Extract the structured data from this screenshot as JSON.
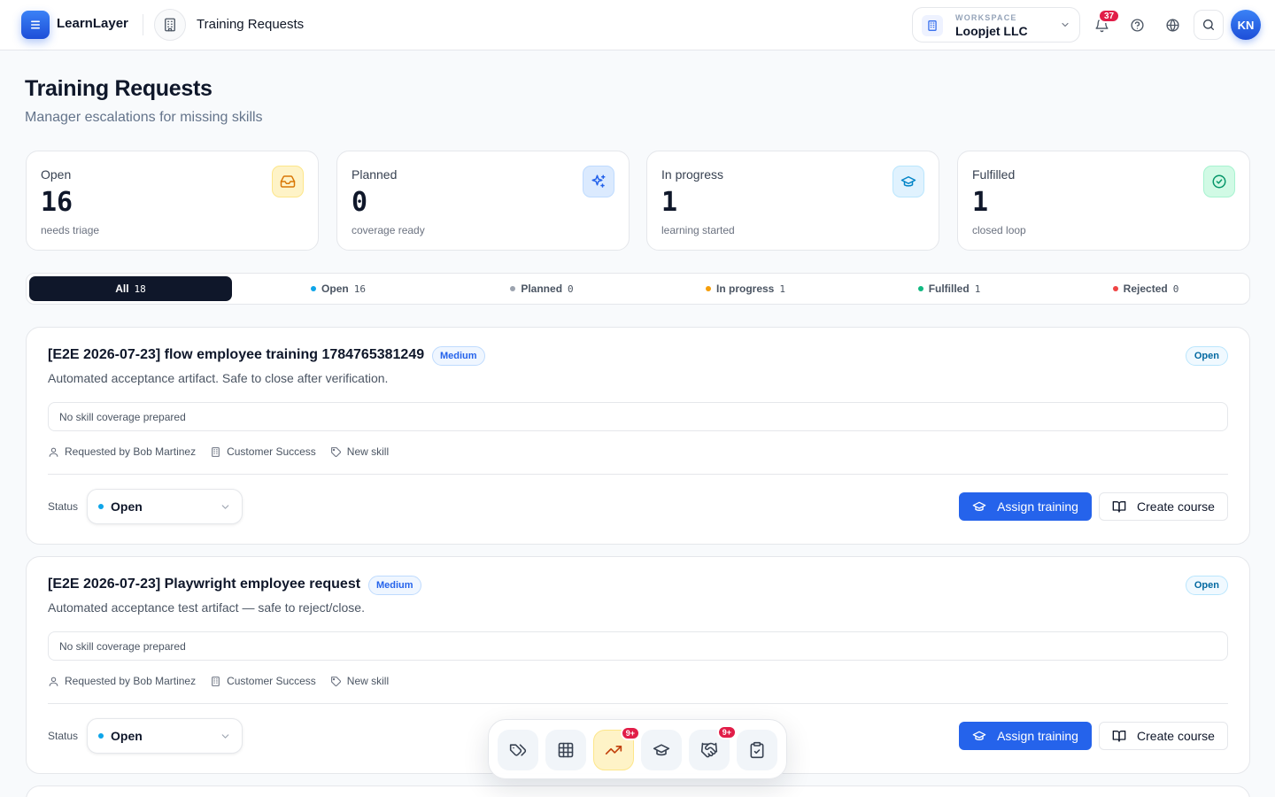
{
  "app": {
    "brand": "LearnLayer",
    "page_breadcrumb": "Training Requests"
  },
  "header": {
    "workspace_label": "WORKSPACE",
    "workspace_name": "Loopjet LLC",
    "notification_count": "37",
    "avatar_initials": "KN"
  },
  "page": {
    "title": "Training Requests",
    "subtitle": "Manager escalations for missing skills"
  },
  "stats": [
    {
      "label": "Open",
      "value": "16",
      "note": "needs triage",
      "icon": "inbox-icon",
      "color": "#d97706"
    },
    {
      "label": "Planned",
      "value": "0",
      "note": "coverage ready",
      "icon": "sparkles-icon",
      "color": "#2563eb"
    },
    {
      "label": "In progress",
      "value": "1",
      "note": "learning started",
      "icon": "graduation-cap-icon",
      "color": "#0284c7"
    },
    {
      "label": "Fulfilled",
      "value": "1",
      "note": "closed loop",
      "icon": "check-circle-icon",
      "color": "#059669"
    }
  ],
  "tabs": [
    {
      "label": "All",
      "count": "18",
      "dot": ""
    },
    {
      "label": "Open",
      "count": "16",
      "dot": "#0ea5e9"
    },
    {
      "label": "Planned",
      "count": "0",
      "dot": "#9ca3af"
    },
    {
      "label": "In progress",
      "count": "1",
      "dot": "#f59e0b"
    },
    {
      "label": "Fulfilled",
      "count": "1",
      "dot": "#10b981"
    },
    {
      "label": "Rejected",
      "count": "0",
      "dot": "#ef4444"
    }
  ],
  "requests": [
    {
      "title": "[E2E 2026-07-23] flow employee training 1784765381249",
      "priority": "Medium",
      "state": "Open",
      "description": "Automated acceptance artifact. Safe to close after verification.",
      "coverage": "No skill coverage prepared",
      "requested_by": "Requested by Bob Martinez",
      "department": "Customer Success",
      "tag": "New skill",
      "status_label": "Status",
      "status_value": "Open",
      "assign_label": "Assign training",
      "create_label": "Create course"
    },
    {
      "title": "[E2E 2026-07-23] Playwright employee request",
      "priority": "Medium",
      "state": "Open",
      "description": "Automated acceptance test artifact — safe to reject/close.",
      "coverage": "No skill coverage prepared",
      "requested_by": "Requested by Bob Martinez",
      "department": "Customer Success",
      "tag": "New skill",
      "status_label": "Status",
      "status_value": "Open",
      "assign_label": "Assign training",
      "create_label": "Create course"
    }
  ],
  "dock": [
    {
      "icon": "tags-icon",
      "badge": ""
    },
    {
      "icon": "grid-icon",
      "badge": ""
    },
    {
      "icon": "trending-up-icon",
      "badge": "9+"
    },
    {
      "icon": "graduation-cap-icon",
      "badge": ""
    },
    {
      "icon": "handshake-icon",
      "badge": "9+"
    },
    {
      "icon": "clipboard-check-icon",
      "badge": ""
    }
  ]
}
